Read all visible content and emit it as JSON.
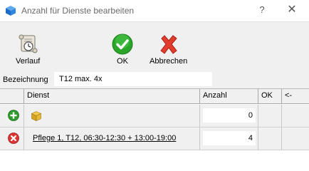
{
  "window": {
    "title": "Anzahl für Dienste bearbeiten",
    "help_label": "?",
    "close_label": "✕"
  },
  "toolbar": {
    "verlauf_label": "Verlauf",
    "ok_label": "OK",
    "abbrechen_label": "Abbrechen"
  },
  "form": {
    "bezeichnung_label": "Bezeichnung",
    "bezeichnung_value": "T12 max. 4x"
  },
  "grid": {
    "columns": [
      "Dienst",
      "Anzahl",
      "OK",
      "<-"
    ],
    "rows": [
      {
        "dienst": "",
        "anzahl": "0",
        "icon": "add-icon"
      },
      {
        "dienst": "Pflege 1, T12, 06:30-12:30 + 13:00-19:00",
        "anzahl": "4",
        "icon": "delete-icon"
      }
    ]
  },
  "colors": {
    "toolbar_bg": "#f0f0f0",
    "ok_green": "#2aa52a",
    "cancel_red": "#e23c2c",
    "add_green": "#2e9d2e",
    "delete_red": "#d33"
  }
}
